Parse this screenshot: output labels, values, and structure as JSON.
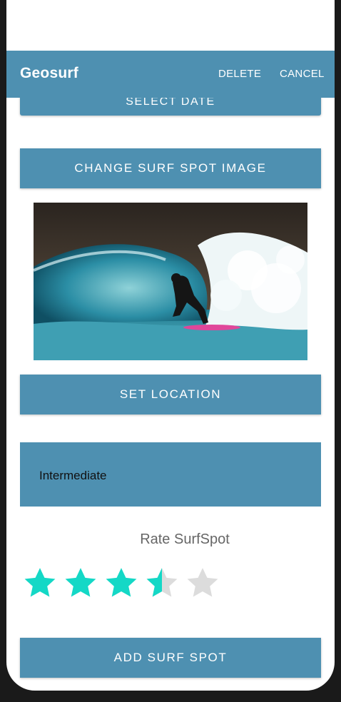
{
  "app_bar": {
    "title": "Geosurf",
    "delete_label": "DELETE",
    "cancel_label": "CANCEL"
  },
  "buttons": {
    "select_date": "SELECT DATE",
    "change_image": "CHANGE SURF SPOT IMAGE",
    "set_location": "SET LOCATION",
    "add_spot": "ADD SURF SPOT"
  },
  "level": {
    "value": "Intermediate"
  },
  "rating": {
    "label": "Rate SurfSpot",
    "value": 3.5,
    "max": 5
  },
  "colors": {
    "primary": "#4e90b1",
    "star_filled": "#14d8c6",
    "star_empty": "#dcdcdc"
  }
}
